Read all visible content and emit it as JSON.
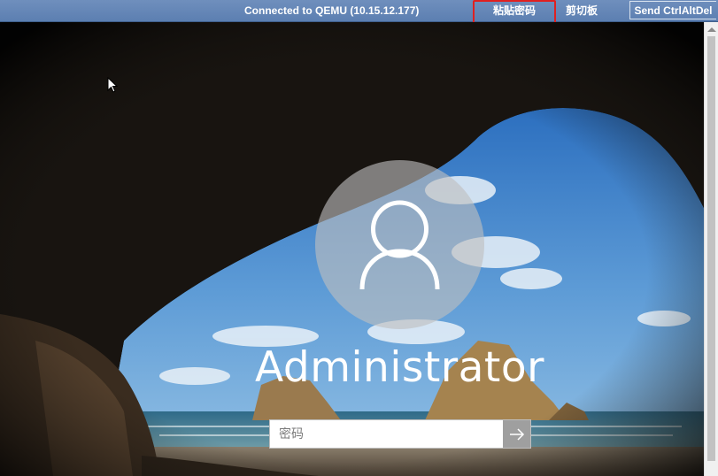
{
  "toolbar": {
    "status": "Connected to QEMU (10.15.12.177)",
    "paste_password_label": "粘贴密码",
    "clipboard_label": "剪切板",
    "send_cad_label": "Send CtrlAltDel"
  },
  "annotation": {
    "color": "#e02020"
  },
  "login": {
    "username": "Administrator",
    "password_placeholder": "密码",
    "submit_icon": "arrow-right-icon",
    "avatar_icon": "user-icon"
  },
  "colors": {
    "toolbar": "#5c7fb1",
    "text": "#ffffff"
  }
}
